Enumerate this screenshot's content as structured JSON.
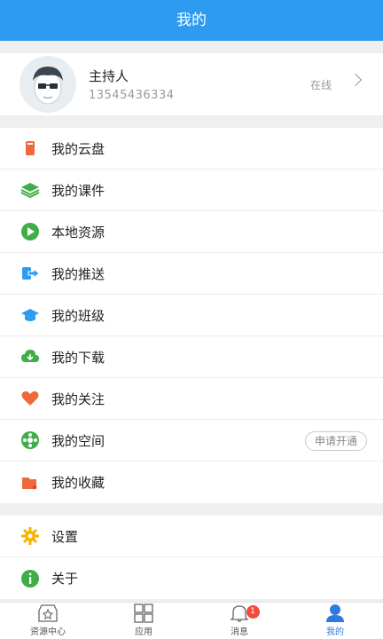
{
  "header": {
    "title": "我的"
  },
  "profile": {
    "name": "主持人",
    "phone": "13545436334",
    "status": "在线"
  },
  "menu1": [
    {
      "label": "我的云盘",
      "icon": "cloud-disk-icon",
      "color": "#f0693a"
    },
    {
      "label": "我的课件",
      "icon": "courseware-layers-icon",
      "color": "#3fae49"
    },
    {
      "label": "本地资源",
      "icon": "play-circle-icon",
      "color": "#3fae49"
    },
    {
      "label": "我的推送",
      "icon": "push-export-icon",
      "color": "#2d9bf0"
    },
    {
      "label": "我的班级",
      "icon": "graduation-cap-icon",
      "color": "#2d9bf0"
    },
    {
      "label": "我的下载",
      "icon": "cloud-download-icon",
      "color": "#3fae49"
    },
    {
      "label": "我的关注",
      "icon": "heart-icon",
      "color": "#f0693a"
    },
    {
      "label": "我的空间",
      "icon": "space-flower-icon",
      "color": "#3fae49",
      "action": "申请开通"
    },
    {
      "label": "我的收藏",
      "icon": "bookmark-folder-icon",
      "color": "#f0693a"
    }
  ],
  "menu2": [
    {
      "label": "设置",
      "icon": "gear-icon",
      "color": "#f5b400"
    },
    {
      "label": "关于",
      "icon": "info-icon",
      "color": "#3fae49"
    }
  ],
  "tabs": [
    {
      "label": "资源中心",
      "icon": "resource-star-icon"
    },
    {
      "label": "应用",
      "icon": "apps-grid-icon"
    },
    {
      "label": "消息",
      "icon": "bell-icon",
      "badge": "1"
    },
    {
      "label": "我的",
      "icon": "user-icon",
      "active": true
    }
  ],
  "colors": {
    "accent": "#2d9bf0",
    "badge": "#f24b3c"
  }
}
